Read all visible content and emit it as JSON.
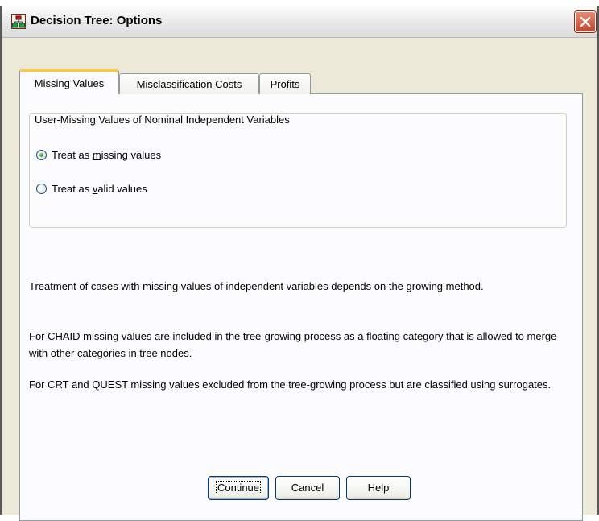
{
  "window": {
    "title": "Decision Tree: Options",
    "close_icon": "close-icon",
    "app_icon": "decision-tree-icon"
  },
  "tabs": [
    {
      "label": "Missing Values",
      "active": true
    },
    {
      "label": "Misclassification Costs",
      "active": false
    },
    {
      "label": "Profits",
      "active": false
    }
  ],
  "group": {
    "legend": "User-Missing Values of Nominal Independent Variables",
    "options": [
      {
        "pre": "Treat as ",
        "mnemonic": "m",
        "post": "issing values",
        "checked": true
      },
      {
        "pre": "Treat as ",
        "mnemonic": "v",
        "post": "alid values",
        "checked": false
      }
    ]
  },
  "info": {
    "paragraph1": "Treatment of cases with missing values of independent variables depends on the growing method.",
    "paragraph2": "For CHAID missing values are included in the tree-growing process as a floating category that is allowed to merge with other categories in tree nodes.",
    "paragraph3": "For CRT and QUEST missing values excluded from the tree-growing process but are classified using surrogates."
  },
  "buttons": {
    "continue": "Continue",
    "cancel": "Cancel",
    "help": "Help"
  },
  "colors": {
    "dialog_bg": "#ece9d8",
    "panel_bg": "#fcfcfe",
    "active_tab_accent": "#ffc83c",
    "close_button": "#c3422a"
  }
}
